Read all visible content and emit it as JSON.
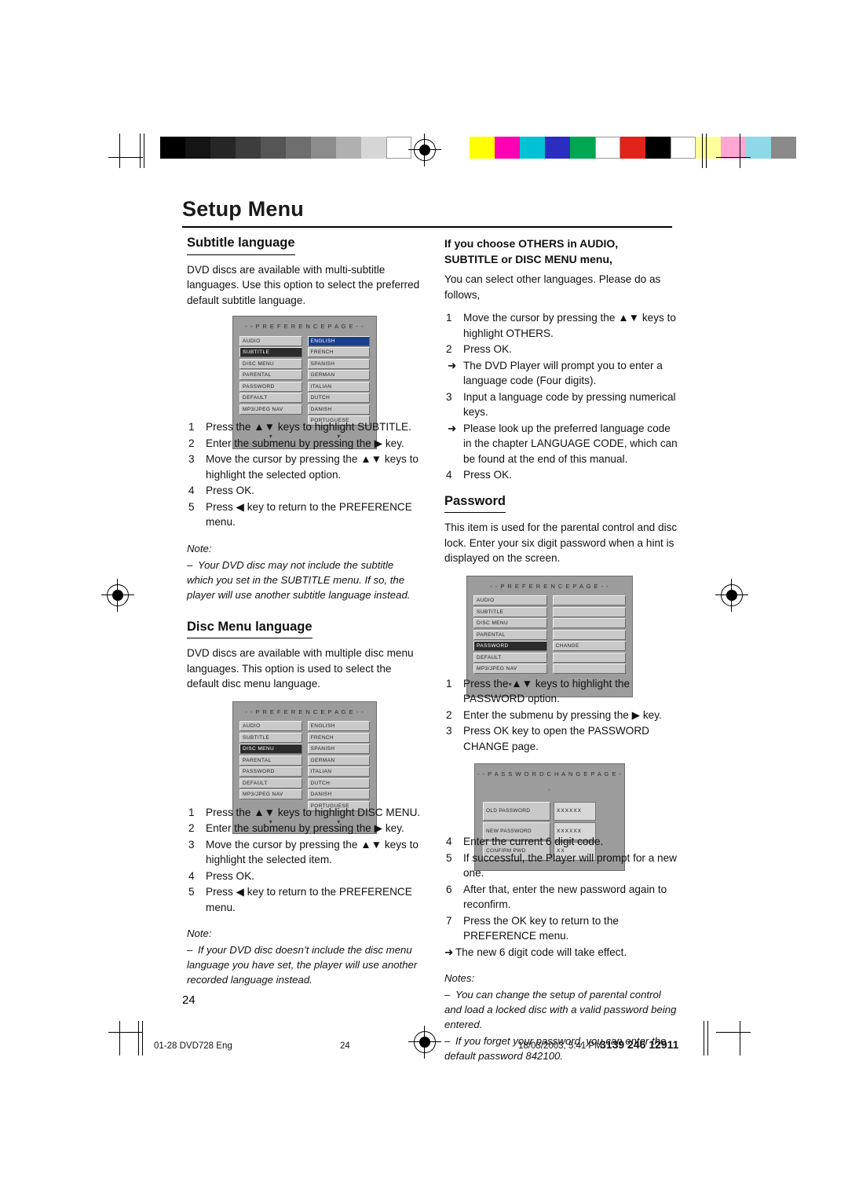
{
  "document": {
    "title": "Setup Menu",
    "page_number": "24"
  },
  "left_column": {
    "subtitle": {
      "heading": "Subtitle language",
      "body": "DVD discs are available with multi-subtitle languages. Use this option to select the preferred default subtitle language.",
      "osd": {
        "title": "- -  P R E F E R E N C E   P A G E  - -",
        "left_items": [
          "AUDIO",
          "SUBTITLE",
          "DISC MENU",
          "PARENTAL",
          "PASSWORD",
          "DEFAULT",
          "MP3/JPEG NAV"
        ],
        "right_items": [
          "ENGLISH",
          "FRENCH",
          "SPANISH",
          "GERMAN",
          "ITALIAN",
          "DUTCH",
          "DANISH",
          "PORTUGUESE"
        ],
        "selected_left": "SUBTITLE",
        "highlighted_right": "ENGLISH"
      },
      "steps": [
        {
          "n": "1",
          "text": "Press the ▲▼ keys to highlight SUBTITLE."
        },
        {
          "n": "2",
          "text": "Enter the submenu by pressing the ▶ key."
        },
        {
          "n": "3",
          "text": "Move the cursor by pressing the ▲▼ keys to highlight the selected option."
        },
        {
          "n": "4",
          "text": "Press OK."
        },
        {
          "n": "5",
          "text": "Press ◀ key to return to the PREFERENCE menu."
        }
      ],
      "note_label": "Note:",
      "note_text": "Your DVD disc may not include the subtitle which you set in the SUBTITLE menu. If so, the player will use another subtitle language instead."
    },
    "disc_menu": {
      "heading": "Disc Menu language",
      "body": "DVD discs are available with multiple disc menu languages. This option is used to select the default disc menu language.",
      "osd": {
        "title": "- -  P R E F E R E N C E   P A G E  - -",
        "left_items": [
          "AUDIO",
          "SUBTITLE",
          "DISC MENU",
          "PARENTAL",
          "PASSWORD",
          "DEFAULT",
          "MP3/JPEG NAV"
        ],
        "right_items": [
          "ENGLISH",
          "FRENCH",
          "SPANISH",
          "GERMAN",
          "ITALIAN",
          "DUTCH",
          "DANISH",
          "PORTUGUESE"
        ],
        "selected_left": "DISC MENU",
        "highlighted_right": ""
      },
      "steps": [
        {
          "n": "1",
          "text": "Press the ▲▼ keys to highlight DISC MENU."
        },
        {
          "n": "2",
          "text": "Enter the submenu by pressing the ▶ key."
        },
        {
          "n": "3",
          "text": "Move the cursor by pressing the ▲▼ keys to highlight the selected item."
        },
        {
          "n": "4",
          "text": "Press OK."
        },
        {
          "n": "5",
          "text": "Press ◀ key to return to the PREFERENCE menu."
        }
      ],
      "note_label": "Note:",
      "note_text": "If your DVD disc doesn’t include the disc menu language you have set, the player will use another recorded language instead."
    }
  },
  "right_column": {
    "others": {
      "heading_line1": "If you choose OTHERS in AUDIO,",
      "heading_line2": "SUBTITLE or DISC MENU menu,",
      "body": "You can select other languages. Please do as follows,",
      "steps": [
        {
          "n": "1",
          "text": "Move the cursor by pressing the ▲▼ keys to highlight OTHERS."
        },
        {
          "n": "2",
          "text": "Press OK."
        },
        {
          "n": "",
          "arrow": "➜",
          "text": "The DVD Player will prompt you to enter a language code (Four digits)."
        },
        {
          "n": "3",
          "text": "Input a language code by pressing numerical keys."
        },
        {
          "n": "",
          "arrow": "➜",
          "text": "Please look up the preferred language code in the chapter LANGUAGE CODE, which can be found at the end of this manual."
        },
        {
          "n": "4",
          "text": "Press OK."
        }
      ]
    },
    "password": {
      "heading": "Password",
      "body": "This item is used for the parental control and disc lock. Enter your six digit password when a hint is displayed on the screen.",
      "osd": {
        "title": "- -  P R E F E R E N C E   P A G E  - -",
        "left_items": [
          "AUDIO",
          "SUBTITLE",
          "DISC MENU",
          "PARENTAL",
          "PASSWORD",
          "DEFAULT",
          "MP3/JPEG NAV"
        ],
        "selected_left": "PASSWORD",
        "right_items": [
          "CHANGE"
        ]
      },
      "steps": [
        {
          "n": "1",
          "text": "Press the ▲▼ keys to highlight the PASSWORD option."
        },
        {
          "n": "2",
          "text": "Enter the submenu by pressing the ▶ key."
        },
        {
          "n": "3",
          "text": "Press OK key to open the PASSWORD CHANGE page."
        }
      ],
      "change_osd": {
        "title": "- -  P A S S W O R D   C H A N G E   P A G E  - -",
        "rows": [
          {
            "label": "OLD PASSWORD",
            "value": "XXXXXX"
          },
          {
            "label": "NEW PASSWORD",
            "value": "XXXXXX"
          },
          {
            "label": "CONFIRM PWD",
            "value": "XX"
          }
        ]
      },
      "steps2": [
        {
          "n": "4",
          "text": "Enter the current 6 digit code."
        },
        {
          "n": "5",
          "text": "If successful, the Player will prompt for a new one."
        },
        {
          "n": "6",
          "text": "After that, enter the new password again to reconfirm."
        },
        {
          "n": "7",
          "text": "Press the OK key to return to the PREFERENCE menu."
        },
        {
          "n": "",
          "arrow": "➜",
          "text": "The new 6 digit code will take effect."
        }
      ],
      "notes_label": "Notes:",
      "notes": [
        "You can change the setup of parental control and load a locked disc with a valid password being entered.",
        "If you forget your password, you can enter the default password 842100."
      ]
    }
  },
  "footer": {
    "left": "01-28 DVD728 Eng",
    "center": "24",
    "right": "18/03/2003, 5:41 PM",
    "code": "3139 246 12911"
  },
  "colors": {
    "swatch_gray": [
      "#000000",
      "#111111",
      "#222222",
      "#3a3a3a",
      "#555555",
      "#6e6e6e",
      "#888888",
      "#aaaaaa",
      "#cccccc",
      "#ffffff"
    ],
    "swatch_color": [
      "#ffff00",
      "#ff00cc",
      "#00c8d2",
      "#2233cc",
      "#00a24a",
      "#ffffff",
      "#e21f26",
      "#000000",
      "#ffffff",
      "#ffff88",
      "#ff99cc",
      "#88ddee",
      "#8a8a8a"
    ]
  }
}
